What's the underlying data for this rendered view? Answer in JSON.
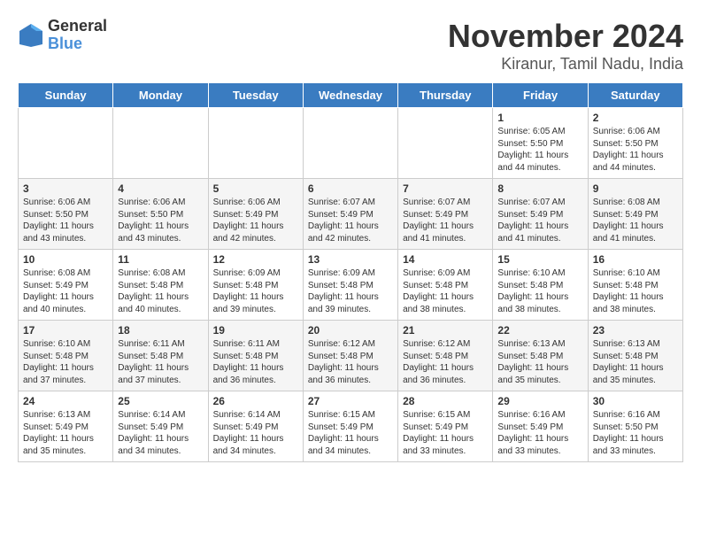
{
  "logo": {
    "general": "General",
    "blue": "Blue"
  },
  "title": "November 2024",
  "subtitle": "Kiranur, Tamil Nadu, India",
  "days_header": [
    "Sunday",
    "Monday",
    "Tuesday",
    "Wednesday",
    "Thursday",
    "Friday",
    "Saturday"
  ],
  "weeks": [
    [
      {
        "day": "",
        "info": ""
      },
      {
        "day": "",
        "info": ""
      },
      {
        "day": "",
        "info": ""
      },
      {
        "day": "",
        "info": ""
      },
      {
        "day": "",
        "info": ""
      },
      {
        "day": "1",
        "info": "Sunrise: 6:05 AM\nSunset: 5:50 PM\nDaylight: 11 hours and 44 minutes."
      },
      {
        "day": "2",
        "info": "Sunrise: 6:06 AM\nSunset: 5:50 PM\nDaylight: 11 hours and 44 minutes."
      }
    ],
    [
      {
        "day": "3",
        "info": "Sunrise: 6:06 AM\nSunset: 5:50 PM\nDaylight: 11 hours and 43 minutes."
      },
      {
        "day": "4",
        "info": "Sunrise: 6:06 AM\nSunset: 5:50 PM\nDaylight: 11 hours and 43 minutes."
      },
      {
        "day": "5",
        "info": "Sunrise: 6:06 AM\nSunset: 5:49 PM\nDaylight: 11 hours and 42 minutes."
      },
      {
        "day": "6",
        "info": "Sunrise: 6:07 AM\nSunset: 5:49 PM\nDaylight: 11 hours and 42 minutes."
      },
      {
        "day": "7",
        "info": "Sunrise: 6:07 AM\nSunset: 5:49 PM\nDaylight: 11 hours and 41 minutes."
      },
      {
        "day": "8",
        "info": "Sunrise: 6:07 AM\nSunset: 5:49 PM\nDaylight: 11 hours and 41 minutes."
      },
      {
        "day": "9",
        "info": "Sunrise: 6:08 AM\nSunset: 5:49 PM\nDaylight: 11 hours and 41 minutes."
      }
    ],
    [
      {
        "day": "10",
        "info": "Sunrise: 6:08 AM\nSunset: 5:49 PM\nDaylight: 11 hours and 40 minutes."
      },
      {
        "day": "11",
        "info": "Sunrise: 6:08 AM\nSunset: 5:48 PM\nDaylight: 11 hours and 40 minutes."
      },
      {
        "day": "12",
        "info": "Sunrise: 6:09 AM\nSunset: 5:48 PM\nDaylight: 11 hours and 39 minutes."
      },
      {
        "day": "13",
        "info": "Sunrise: 6:09 AM\nSunset: 5:48 PM\nDaylight: 11 hours and 39 minutes."
      },
      {
        "day": "14",
        "info": "Sunrise: 6:09 AM\nSunset: 5:48 PM\nDaylight: 11 hours and 38 minutes."
      },
      {
        "day": "15",
        "info": "Sunrise: 6:10 AM\nSunset: 5:48 PM\nDaylight: 11 hours and 38 minutes."
      },
      {
        "day": "16",
        "info": "Sunrise: 6:10 AM\nSunset: 5:48 PM\nDaylight: 11 hours and 38 minutes."
      }
    ],
    [
      {
        "day": "17",
        "info": "Sunrise: 6:10 AM\nSunset: 5:48 PM\nDaylight: 11 hours and 37 minutes."
      },
      {
        "day": "18",
        "info": "Sunrise: 6:11 AM\nSunset: 5:48 PM\nDaylight: 11 hours and 37 minutes."
      },
      {
        "day": "19",
        "info": "Sunrise: 6:11 AM\nSunset: 5:48 PM\nDaylight: 11 hours and 36 minutes."
      },
      {
        "day": "20",
        "info": "Sunrise: 6:12 AM\nSunset: 5:48 PM\nDaylight: 11 hours and 36 minutes."
      },
      {
        "day": "21",
        "info": "Sunrise: 6:12 AM\nSunset: 5:48 PM\nDaylight: 11 hours and 36 minutes."
      },
      {
        "day": "22",
        "info": "Sunrise: 6:13 AM\nSunset: 5:48 PM\nDaylight: 11 hours and 35 minutes."
      },
      {
        "day": "23",
        "info": "Sunrise: 6:13 AM\nSunset: 5:48 PM\nDaylight: 11 hours and 35 minutes."
      }
    ],
    [
      {
        "day": "24",
        "info": "Sunrise: 6:13 AM\nSunset: 5:49 PM\nDaylight: 11 hours and 35 minutes."
      },
      {
        "day": "25",
        "info": "Sunrise: 6:14 AM\nSunset: 5:49 PM\nDaylight: 11 hours and 34 minutes."
      },
      {
        "day": "26",
        "info": "Sunrise: 6:14 AM\nSunset: 5:49 PM\nDaylight: 11 hours and 34 minutes."
      },
      {
        "day": "27",
        "info": "Sunrise: 6:15 AM\nSunset: 5:49 PM\nDaylight: 11 hours and 34 minutes."
      },
      {
        "day": "28",
        "info": "Sunrise: 6:15 AM\nSunset: 5:49 PM\nDaylight: 11 hours and 33 minutes."
      },
      {
        "day": "29",
        "info": "Sunrise: 6:16 AM\nSunset: 5:49 PM\nDaylight: 11 hours and 33 minutes."
      },
      {
        "day": "30",
        "info": "Sunrise: 6:16 AM\nSunset: 5:50 PM\nDaylight: 11 hours and 33 minutes."
      }
    ]
  ]
}
